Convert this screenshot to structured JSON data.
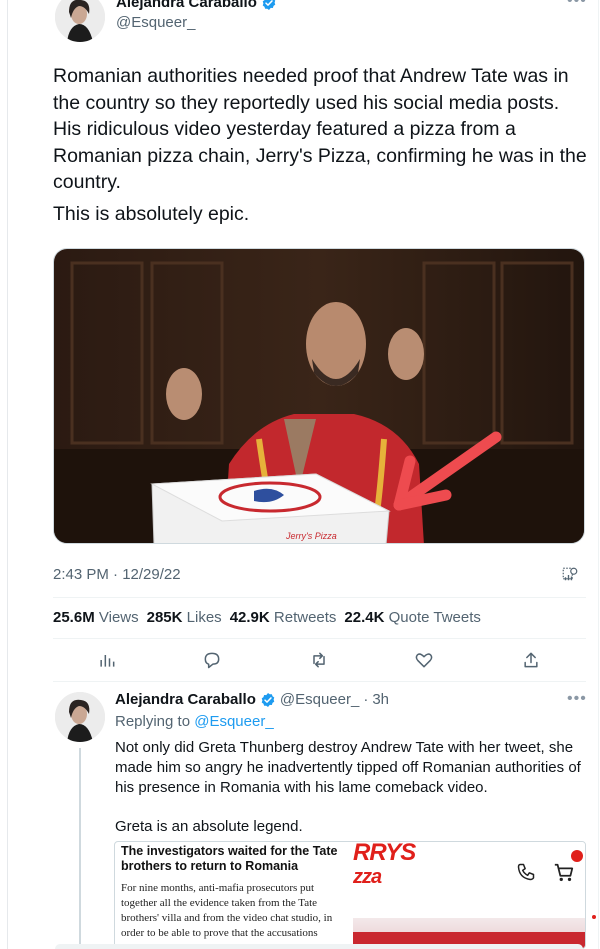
{
  "main_tweet": {
    "author_name": "Alejandra Caraballo",
    "author_handle": "@Esqueer_",
    "more_icon": "more-icon",
    "text_para1": "Romanian authorities needed proof that Andrew Tate was in the country so they reportedly used his social media posts. His ridiculous video yesterday featured a pizza from a Romanian pizza chain, Jerry's Pizza, confirming he was in the country.",
    "text_para2": "This is absolutely epic.",
    "media_pizza_box_text": "Jerry's Pizza",
    "timestamp": "2:43 PM · 12/29/22",
    "stats": {
      "views_count": "25.6M",
      "views_label": "Views",
      "likes_count": "285K",
      "likes_label": "Likes",
      "retweets_count": "42.9K",
      "retweets_label": "Retweets",
      "quotes_count": "22.4K",
      "quotes_label": "Quote Tweets"
    },
    "actions": [
      "analytics-icon",
      "reply-icon",
      "retweet-icon",
      "like-icon",
      "share-icon"
    ]
  },
  "reply_tweet": {
    "author_name": "Alejandra Caraballo",
    "author_handle": "@Esqueer_",
    "separator": "·",
    "time_ago": "3h",
    "replying_prefix": "Replying to",
    "replying_handle": "@Esqueer_",
    "text_para1": "Not only did Greta Thunberg destroy Andrew Tate with her tweet, she made him so angry he inadvertently tipped off Romanian authorities of his presence in Romania with his lame comeback video.",
    "text_para2": "Greta is an absolute legend.",
    "article": {
      "title": "The investigators waited for the Tate brothers to return to Romania",
      "body": "For nine months, anti-mafia prosecutors put together all the evidence taken from the Tate brothers' villa and from the video chat studio, in order to be able to prove that the accusations",
      "logo_line1": "RRYS",
      "logo_line2": "zza"
    }
  },
  "colors": {
    "text_primary": "#0f1419",
    "text_secondary": "#536471",
    "link_blue": "#1d9bf0",
    "verified_blue": "#1d9bf0",
    "arrow_red": "#ee4b4f",
    "jerrys_red": "#e0201b"
  }
}
